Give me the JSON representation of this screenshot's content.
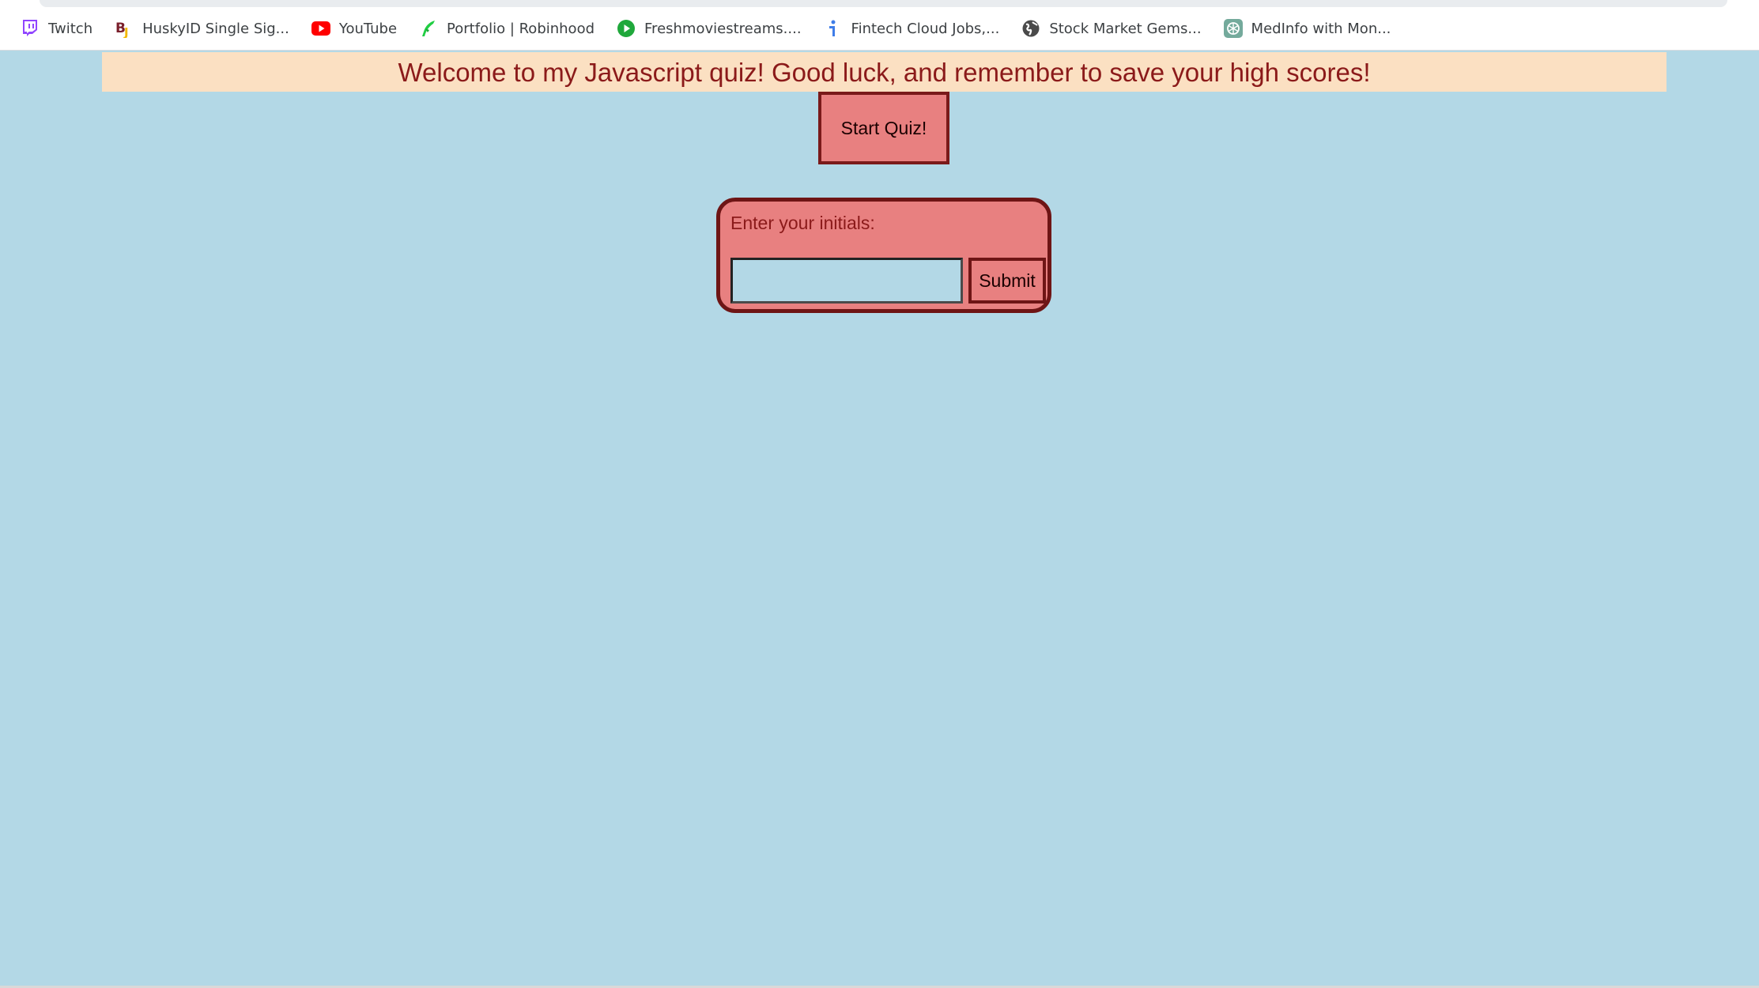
{
  "bookmarks": [
    {
      "label": "Twitch",
      "icon": "twitch-icon"
    },
    {
      "label": "HuskyID Single Sig...",
      "icon": "huskyid-icon"
    },
    {
      "label": "YouTube",
      "icon": "youtube-icon"
    },
    {
      "label": "Portfolio | Robinhood",
      "icon": "robinhood-icon"
    },
    {
      "label": "Freshmoviestreams....",
      "icon": "play-circle-icon"
    },
    {
      "label": "Fintech Cloud Jobs,...",
      "icon": "info-icon"
    },
    {
      "label": "Stock Market Gems...",
      "icon": "globe-icon"
    },
    {
      "label": "MedInfo with Mon...",
      "icon": "openai-icon"
    }
  ],
  "page": {
    "banner_text": "Welcome to my Javascript quiz! Good luck, and remember to save your high scores!",
    "start_button_label": "Start Quiz!",
    "initials_label": "Enter your initials:",
    "initials_value": "",
    "submit_label": "Submit"
  },
  "colors": {
    "background": "#b3d8e6",
    "banner_bg": "#fbe0c2",
    "banner_text": "#8b1a1a",
    "button_bg": "#e88080",
    "button_border": "#7a1a1a"
  }
}
